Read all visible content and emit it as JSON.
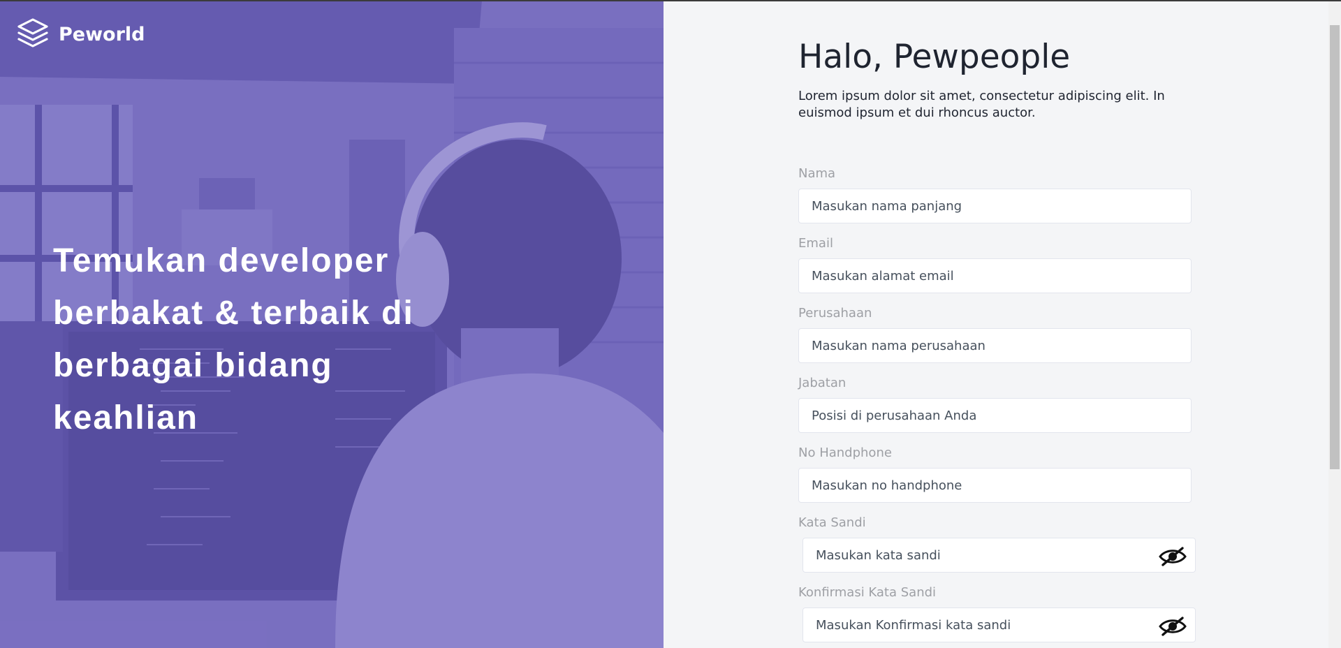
{
  "brand": {
    "name": "Peworld",
    "logo_icon": "layers-stack-icon"
  },
  "hero": {
    "title": "Temukan developer berbakat & terbaik di berbagai bidang keahlian",
    "overlay_color": "#6c60be"
  },
  "form": {
    "greeting": "Halo, Pewpeople",
    "subtitle": "Lorem ipsum dolor sit amet, consectetur adipiscing elit. In euismod ipsum et dui rhoncus auctor.",
    "fields": [
      {
        "label": "Nama",
        "placeholder": "Masukan nama panjang"
      },
      {
        "label": "Email",
        "placeholder": "Masukan alamat email"
      },
      {
        "label": "Perusahaan",
        "placeholder": "Masukan nama perusahaan"
      },
      {
        "label": "Jabatan",
        "placeholder": "Posisi di perusahaan Anda"
      },
      {
        "label": "No Handphone",
        "placeholder": "Masukan no handphone"
      },
      {
        "label": "Kata Sandi",
        "placeholder": "Masukan kata sandi",
        "toggle_icon": "eye-slash-icon"
      },
      {
        "label": "Konfirmasi Kata Sandi",
        "placeholder": "Masukan Konfirmasi kata sandi",
        "toggle_icon": "eye-slash-icon"
      }
    ]
  },
  "colors": {
    "accent": "#6c60be",
    "panel_bg": "#f4f5f7",
    "label": "#9ea0a5",
    "text_dark": "#1f2430"
  }
}
